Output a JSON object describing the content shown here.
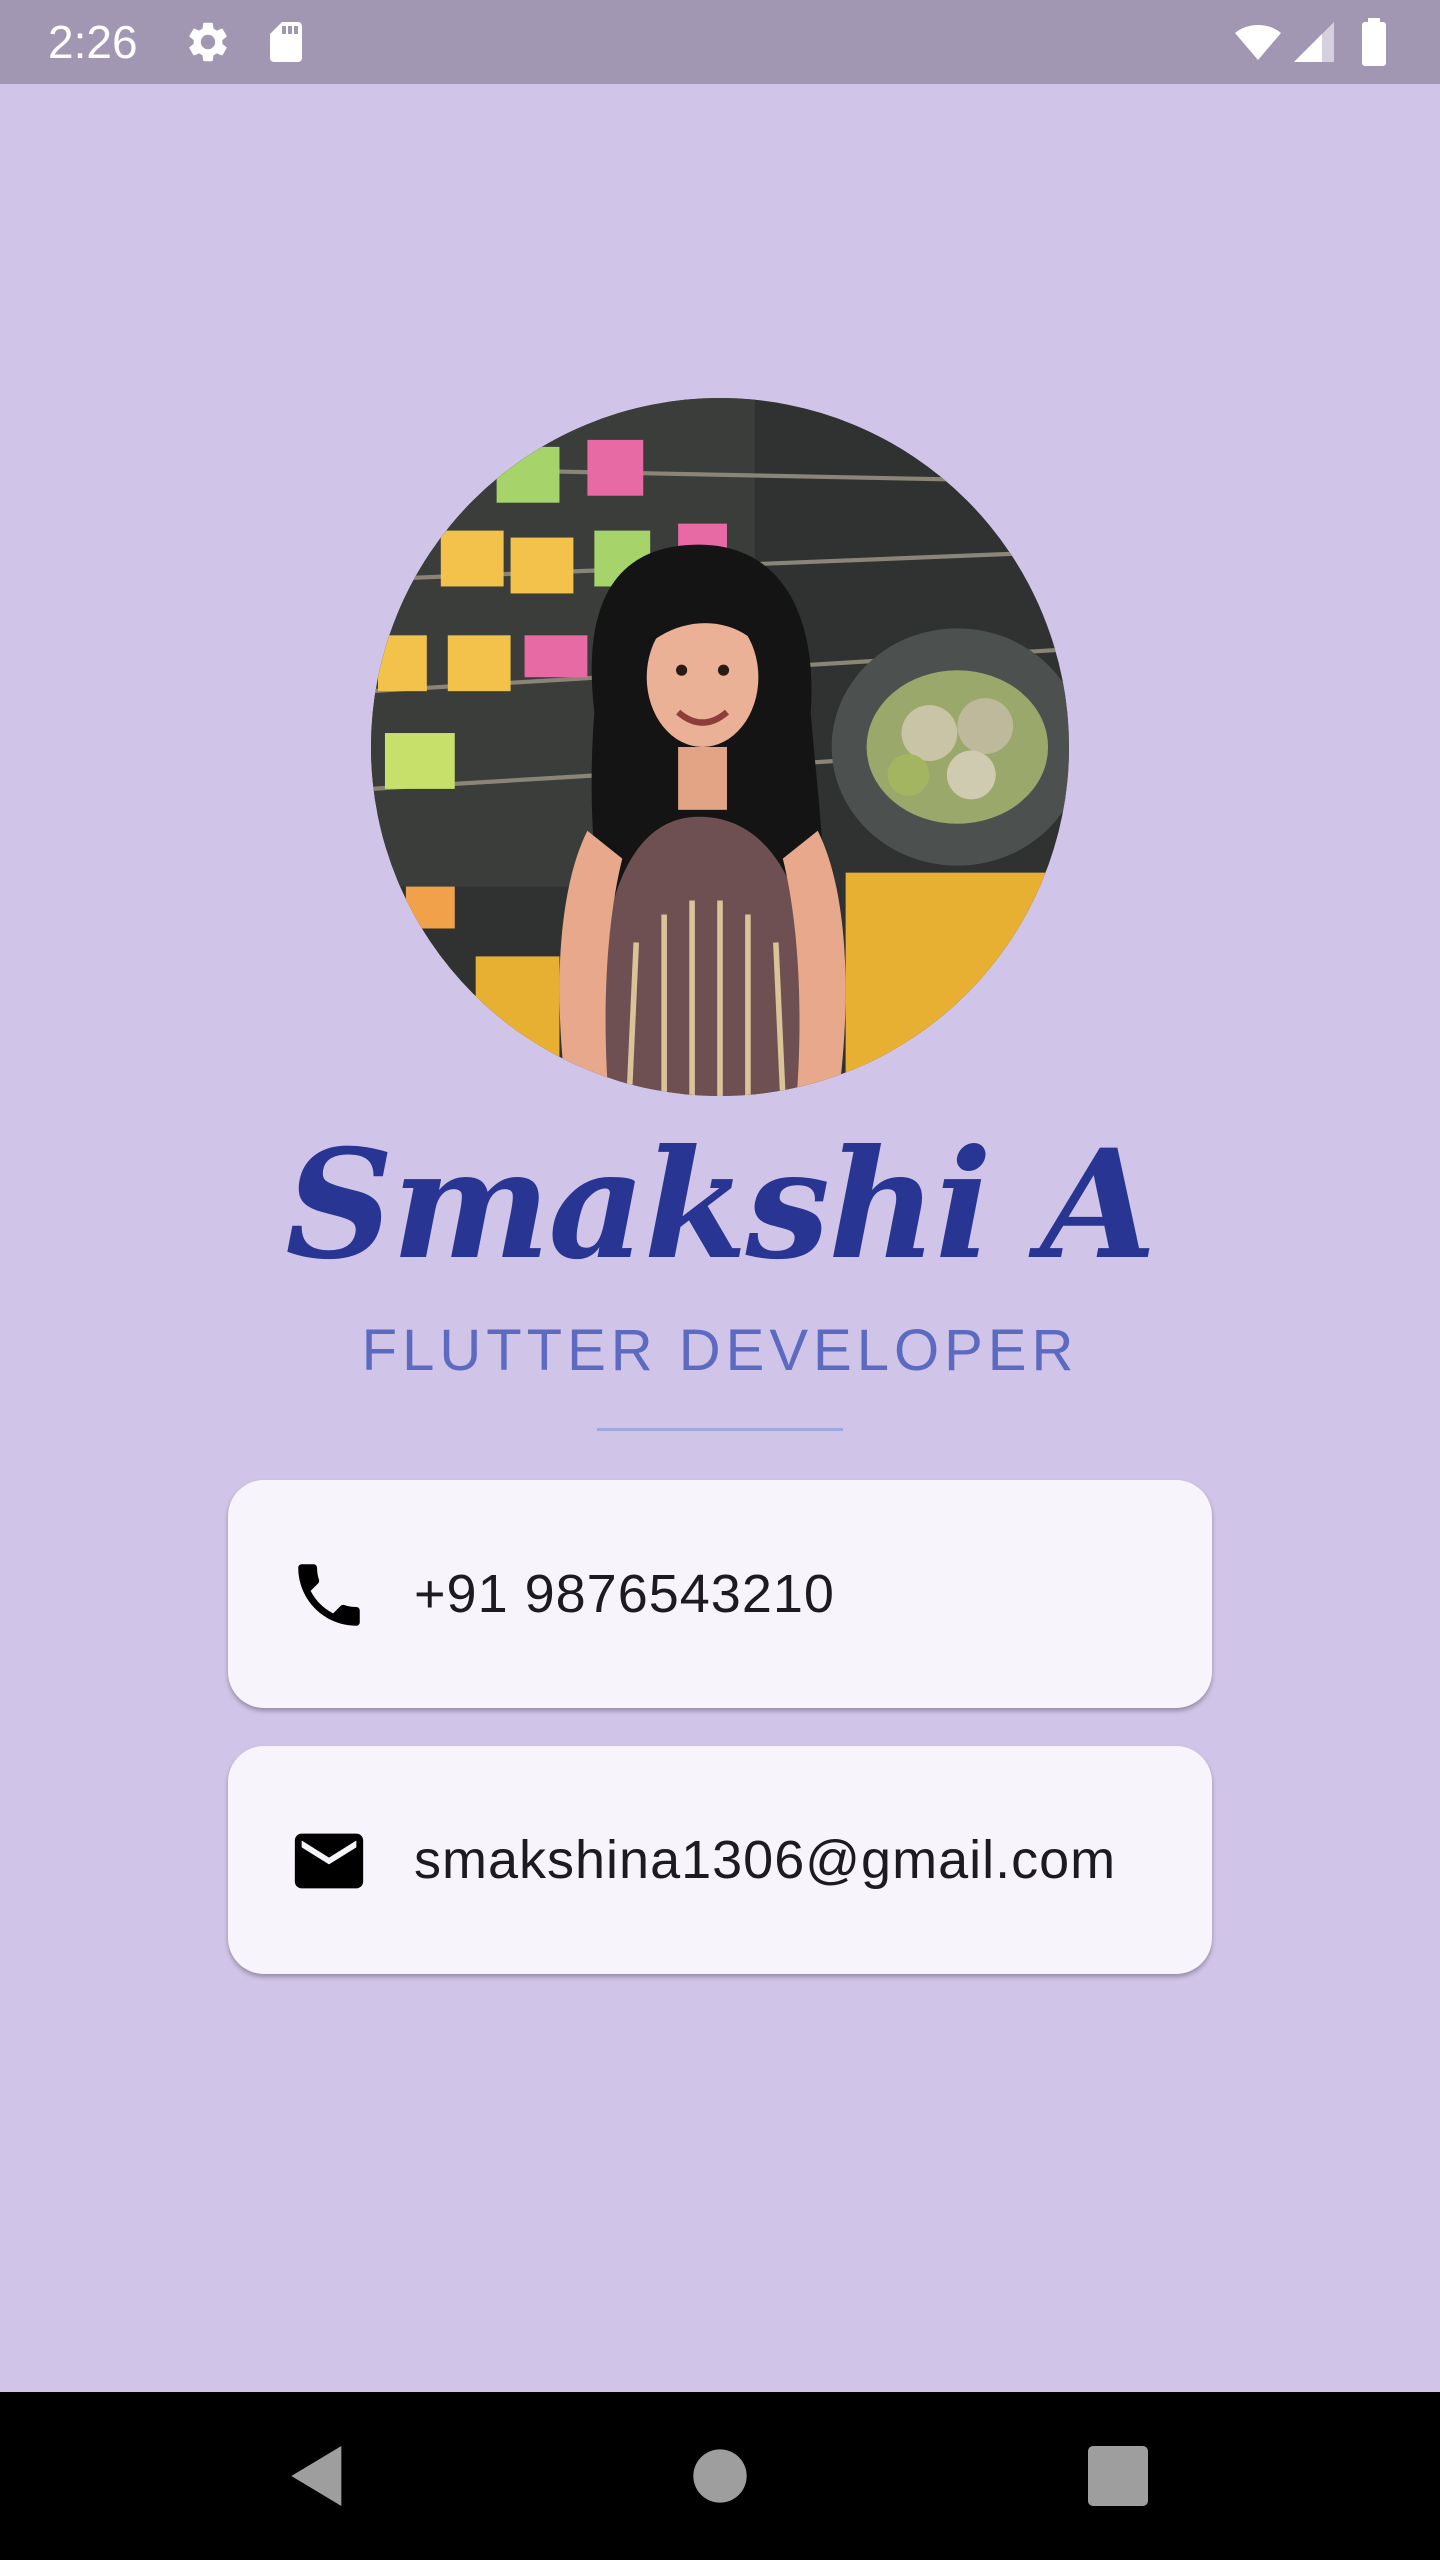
{
  "status_bar": {
    "time": "2:26",
    "icons": [
      "settings-icon",
      "sd-card-icon",
      "wifi-icon",
      "signal-icon",
      "battery-icon"
    ]
  },
  "profile": {
    "name": "Smakshi A",
    "title": "FLUTTER DEVELOPER"
  },
  "contacts": {
    "phone": {
      "icon": "phone-icon",
      "value": "+91 9876543210"
    },
    "email": {
      "icon": "mail-icon",
      "value": "smakshina1306@gmail.com"
    }
  },
  "nav_bar": {
    "buttons": [
      "back-icon",
      "home-icon",
      "recents-icon"
    ]
  },
  "colors": {
    "background": "#d1c4e9",
    "status_bar": "#a197b3",
    "name": "#283593",
    "title": "#5c6bc0",
    "divider": "#9fa8da",
    "card": "#f7f5fb"
  }
}
